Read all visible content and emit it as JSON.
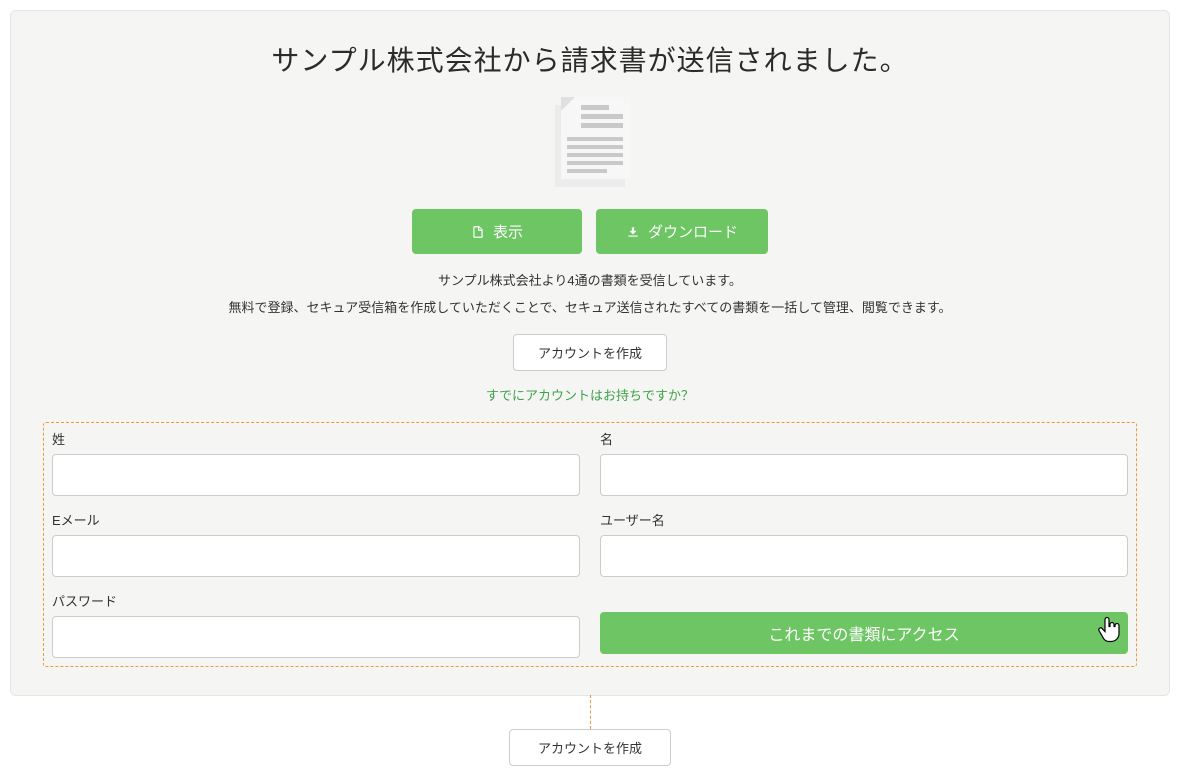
{
  "title": "サンプル株式会社から請求書が送信されました。",
  "buttons": {
    "view": "表示",
    "download": "ダウンロード"
  },
  "messages": {
    "received": "サンプル株式会社より4通の書類を受信しています。",
    "info": "無料で登録、セキュア受信箱を作成していただくことで、セキュア送信されたすべての書類を一括して管理、閲覧できます。"
  },
  "create_account_button": "アカウントを作成",
  "already_have": "すでにアカウントはお持ちですか？",
  "form": {
    "last_name": "姓",
    "first_name": "名",
    "email": "Eメール",
    "username": "ユーザー名",
    "password": "パスワード",
    "submit": "これまでの書類にアクセス"
  },
  "callout": "アカウントを作成"
}
